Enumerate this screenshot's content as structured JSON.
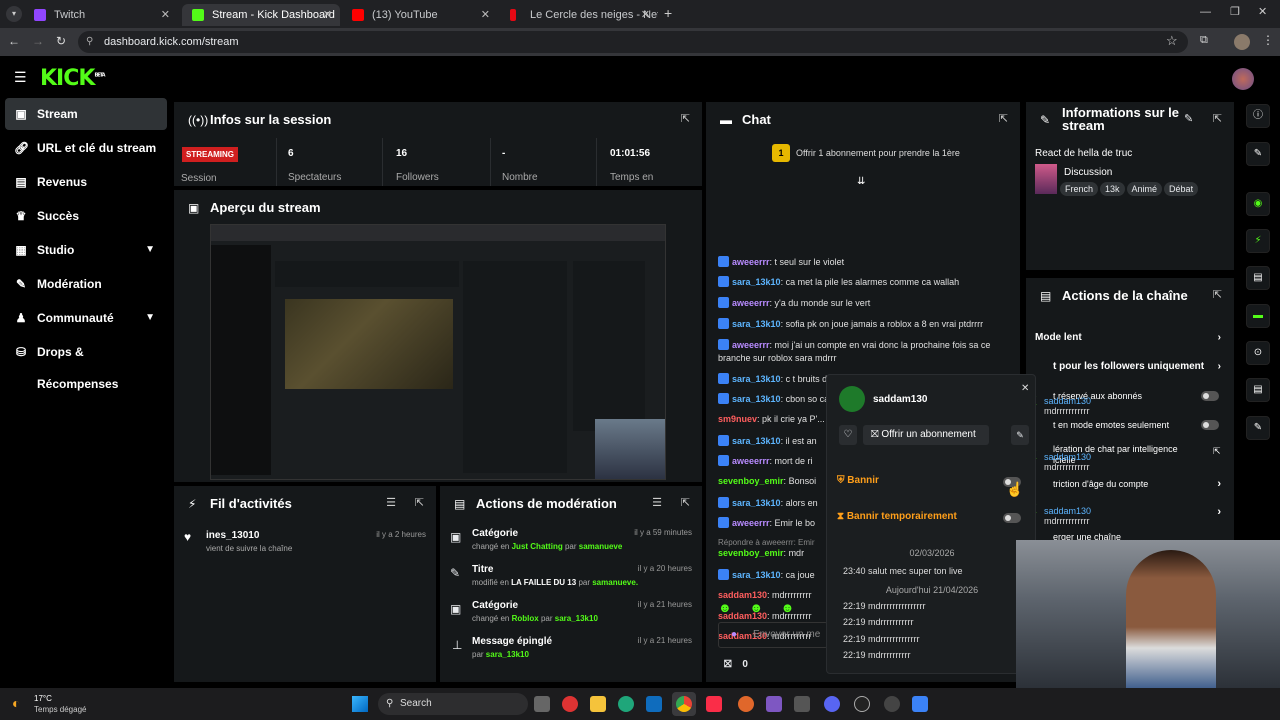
{
  "browser": {
    "tabs": [
      {
        "title": "Twitch",
        "active": false
      },
      {
        "title": "Stream - Kick Dashboard",
        "active": true
      },
      {
        "title": "(13) YouTube",
        "active": false
      },
      {
        "title": "Le Cercle des neiges - Netflix",
        "active": false
      }
    ],
    "url": "dashboard.kick.com/stream"
  },
  "header": {
    "logo": "KICK",
    "logo_badge": "BETA"
  },
  "sidebar": {
    "items": [
      {
        "label": "Stream",
        "icon": "stream-icon",
        "active": true
      },
      {
        "label": "URL et clé du stream",
        "icon": "link-icon"
      },
      {
        "label": "Revenus",
        "icon": "revenue-icon"
      },
      {
        "label": "Succès",
        "icon": "trophy-icon"
      },
      {
        "label": "Studio",
        "icon": "studio-icon",
        "chevron": true
      },
      {
        "label": "Modération",
        "icon": "wrench-icon"
      },
      {
        "label": "Communauté",
        "icon": "community-icon",
        "chevron": true
      },
      {
        "label": "Drops & Récompenses",
        "icon": "drops-icon"
      }
    ]
  },
  "session": {
    "title": "Infos sur la session",
    "status_badge": "STREAMING",
    "status_label": "Session",
    "stats": [
      {
        "value": "6",
        "label": "Spectateurs"
      },
      {
        "value": "16",
        "label": "Followers"
      },
      {
        "value": "-",
        "label": "Nombre d'abonnés"
      },
      {
        "value": "01:01:56",
        "label": "Temps en diffusion"
      }
    ]
  },
  "preview": {
    "title": "Aperçu du stream"
  },
  "activity": {
    "title": "Fil d'activités",
    "items": [
      {
        "user": "ines_13010",
        "text": "vient de suivre la chaîne",
        "time": "il y a 2 heures"
      }
    ]
  },
  "moderation": {
    "title": "Actions de modération",
    "items": [
      {
        "title": "Catégorie",
        "prefix": "changé en",
        "value": "Just Chatting",
        "by": "par",
        "user": "samanueve",
        "time": "il y a 59 minutes"
      },
      {
        "title": "Titre",
        "prefix": "modifié en",
        "value": "LA FAILLE DU 13",
        "by": "par",
        "user": "samanueve.",
        "time": "il y a 20 heures"
      },
      {
        "title": "Catégorie",
        "prefix": "changé en",
        "value": "Roblox",
        "by": "par",
        "user": "sara_13k10",
        "time": "il y a 21 heures"
      },
      {
        "title": "Message épinglé",
        "prefix": "",
        "value": "",
        "by": "par",
        "user": "sara_13k10",
        "time": "il y a 21 heures"
      }
    ]
  },
  "chat": {
    "title": "Chat",
    "gift_count": "1",
    "gift_text": "Offrir 1 abonnement pour prendre la 1ère",
    "messages": [
      {
        "user": "aweeerrr",
        "color": "purple",
        "text": "t seul sur le violet"
      },
      {
        "user": "sara_13k10",
        "color": "blue",
        "text": "ca met la pile les alarmes comme ca wallah"
      },
      {
        "user": "aweeerrr",
        "color": "purple",
        "text": "y'a du monde sur le vert"
      },
      {
        "user": "sara_13k10",
        "color": "blue",
        "text": "sofia pk on joue jamais a roblox a 8 en vrai ptdrrrr"
      },
      {
        "user": "aweeerrr",
        "color": "purple",
        "text": "moi j'ai un compte en vrai donc la prochaine fois sa ce"
      },
      {
        "user": "",
        "color": "",
        "text": "branche sur roblox sara mdrrr"
      },
      {
        "user": "sara_13k10",
        "color": "blue",
        "text": "c t bruits de pas a toi nn ptdrrrr"
      },
      {
        "user": "sara_13k10",
        "color": "blue",
        "text": "cbon so carrestre"
      },
      {
        "user": "sm9nuev",
        "color": "red",
        "text": "pk il crie ya P'..."
      },
      {
        "user": "sara_13k10",
        "color": "blue",
        "text": "il est an"
      },
      {
        "user": "aweeerrr",
        "color": "purple",
        "text": "mort de ri"
      },
      {
        "user": "sevenboy_emir",
        "color": "green",
        "text": "Bonsoi"
      },
      {
        "user": "sara_13k10",
        "color": "blue",
        "text": "alors en"
      },
      {
        "user": "aweeerrr",
        "color": "purple",
        "text": "Emir le bo"
      },
      {
        "user": "",
        "color": "",
        "text": "Répondre à aweeerrr: Emir"
      },
      {
        "user": "sevenboy_emir",
        "color": "green",
        "text": "mdr"
      },
      {
        "user": "sara_13k10",
        "color": "blue",
        "text": "ca joue"
      },
      {
        "user": "saddam130",
        "color": "red",
        "text": "mdrrrrrrrrr"
      },
      {
        "user": "saddam130",
        "color": "red",
        "text": "mdrrrrrrrrr"
      },
      {
        "user": "saddam130",
        "color": "red",
        "text": "mdrrrrrrrrr"
      }
    ],
    "input_placeholder": "Envoyer un me",
    "footer_count": "0"
  },
  "stream_info": {
    "title": "Informations sur le stream",
    "stream_title": "React de hella de truc",
    "category": "Discussion",
    "tags": [
      "French",
      "13k",
      "Animé",
      "Débat"
    ]
  },
  "channel_actions": {
    "title": "Actions de la chaîne",
    "items": [
      {
        "label": "Mode lent",
        "control": "chevron"
      },
      {
        "label": "t pour les followers uniquement",
        "control": "chevron"
      },
      {
        "label": "t réservé aux abonnés",
        "control": "toggle"
      },
      {
        "label": "t en mode emotes seulement",
        "control": "toggle"
      },
      {
        "label": "lération de chat par intelligence icielle",
        "control": "external"
      },
      {
        "label": "triction d'âge du compte",
        "control": "chevron"
      },
      {
        "label": "erger une chaîne",
        "control": "chevron"
      }
    ]
  },
  "user_popup": {
    "username": "saddam130",
    "gift_button": "Offrir un abonnement",
    "ban_label": "Bannir",
    "timeout_label": "Bannir temporairement",
    "date_1": "02/03/2026",
    "log_1": "23:40 salut mec super ton live",
    "date_2": "Aujourd'hui 21/04/2026",
    "logs_2": [
      "22:19 mdrrrrrrrrrrrrrrr",
      "22:19 mdrrrrrrrrrrr",
      "22:19 mdrrrrrrrrrrrrr",
      "22:19 mdrrrrrrrrrr"
    ]
  },
  "overlay_names": [
    "saddam130",
    "mdrrrrrrrrrrr",
    "saddam130",
    "mdrrrrrrrrrrr",
    "saddam130",
    "mdrrrrrrrrrrr"
  ],
  "taskbar": {
    "weather_temp": "17°C",
    "weather_text": "Temps dégagé",
    "search": "Search"
  },
  "colors": {
    "brand": "#53fc18",
    "streaming_badge": "#d01f1f"
  }
}
